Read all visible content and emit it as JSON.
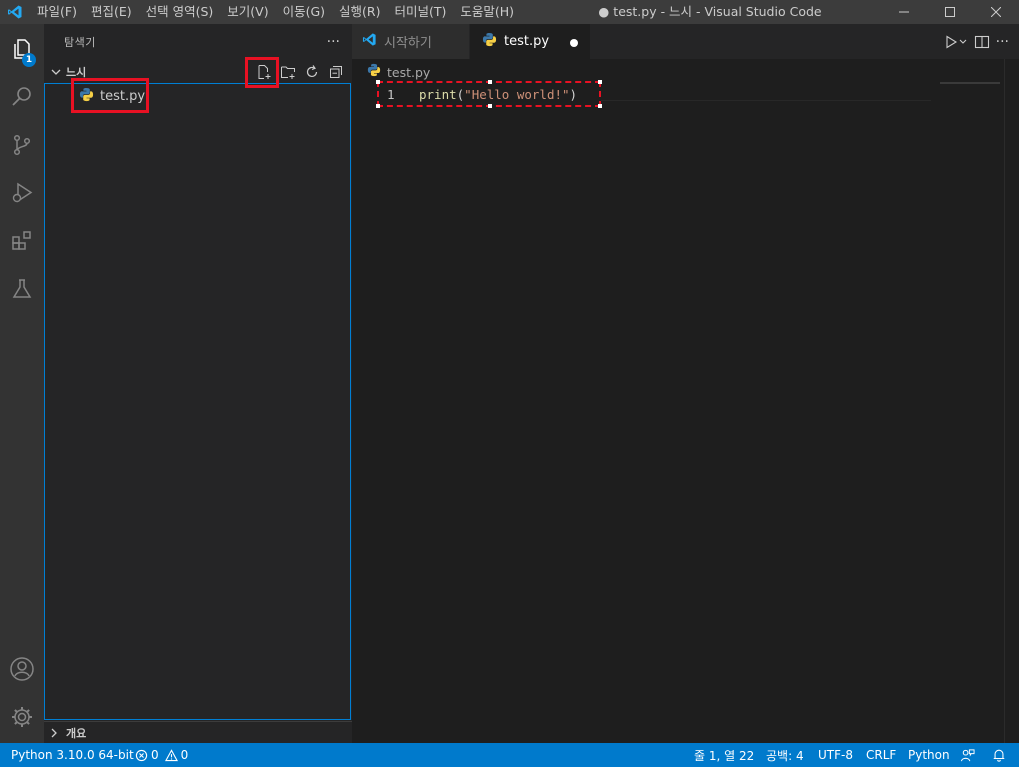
{
  "titlebar": {
    "menu": [
      "파일(F)",
      "편집(E)",
      "선택 영역(S)",
      "보기(V)",
      "이동(G)",
      "실행(R)",
      "터미널(T)",
      "도움말(H)"
    ],
    "title": "● test.py - 느시 - Visual Studio Code"
  },
  "activitybar": {
    "explorer_badge": "1",
    "icons": [
      "explorer-icon",
      "search-icon",
      "source-control-icon",
      "run-debug-icon",
      "extensions-icon",
      "testing-icon",
      "account-icon",
      "manage-gear-icon"
    ]
  },
  "sidebar": {
    "title": "탐색기",
    "more": "···",
    "folder_name": "느시",
    "files": [
      {
        "name": "test.py",
        "icon": "python-file-icon"
      }
    ],
    "outline_label": "개요"
  },
  "editor": {
    "tabs": [
      {
        "label": "시작하기",
        "icon": "vscode-logo-icon",
        "active": false
      },
      {
        "label": "test.py",
        "icon": "python-file-icon",
        "active": true,
        "dirty": true
      }
    ],
    "breadcrumb": "test.py",
    "lines": [
      {
        "number": "1",
        "fn": "print",
        "open": "(",
        "string": "\"Hello world!\"",
        "close": ")"
      }
    ]
  },
  "statusbar": {
    "interpreter": "Python 3.10.0 64-bit",
    "errors": "0",
    "warnings": "0",
    "position": "줄 1, 열 22",
    "indent": "공백: 4",
    "encoding": "UTF-8",
    "eol": "CRLF",
    "language": "Python"
  },
  "colors": {
    "accent": "#007acc",
    "highlight": "#e81123",
    "titlebar": "#3c3c3c",
    "activitybar": "#333333",
    "sidebar": "#252526",
    "editor": "#1e1e1e"
  }
}
